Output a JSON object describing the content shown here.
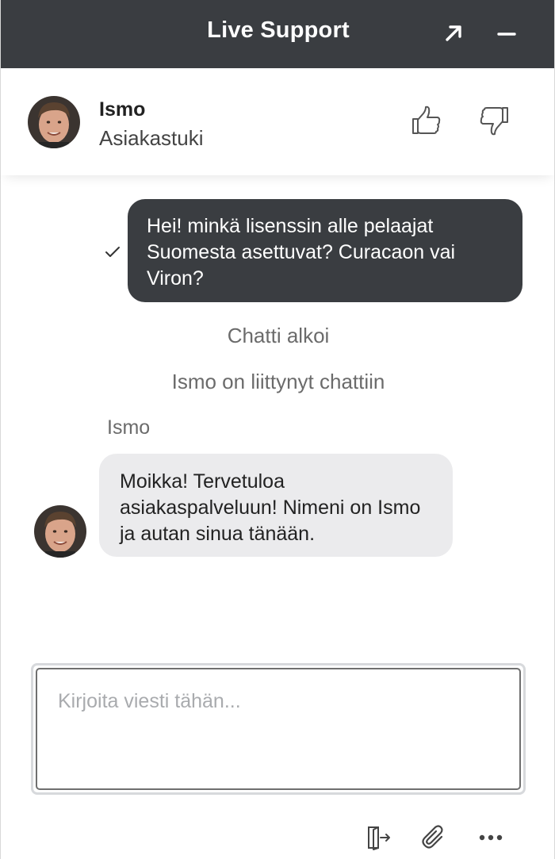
{
  "window": {
    "title": "Live Support",
    "popout_icon": "arrow-up-right-icon",
    "minimize_icon": "minus-icon"
  },
  "agent": {
    "name": "Ismo",
    "role": "Asiakastuki",
    "rate_up_icon": "thumbs-up-icon",
    "rate_down_icon": "thumbs-down-icon"
  },
  "messages": {
    "outgoing": {
      "text": "Hei! minkä lisenssin alle pelaajat Suomesta asettuvat? Curacaon vai Viron?",
      "status_icon": "check-icon"
    },
    "system": [
      "Chatti alkoi",
      "Ismo on liittynyt chattiin"
    ],
    "incoming": {
      "sender": "Ismo",
      "text": "Moikka! Tervetuloa asiakaspalveluun! Nimeni on Ismo ja autan sinua tänään."
    }
  },
  "composer": {
    "placeholder": "Kirjoita viesti tähän...",
    "value": ""
  },
  "footer": {
    "icons": [
      "exit-icon",
      "paperclip-icon",
      "more-icon"
    ]
  },
  "colors": {
    "titlebar": "#3a3d41",
    "outgoing_bubble": "#3a3d41",
    "incoming_bubble": "#ebebed",
    "system_text": "#6b6b6b"
  }
}
